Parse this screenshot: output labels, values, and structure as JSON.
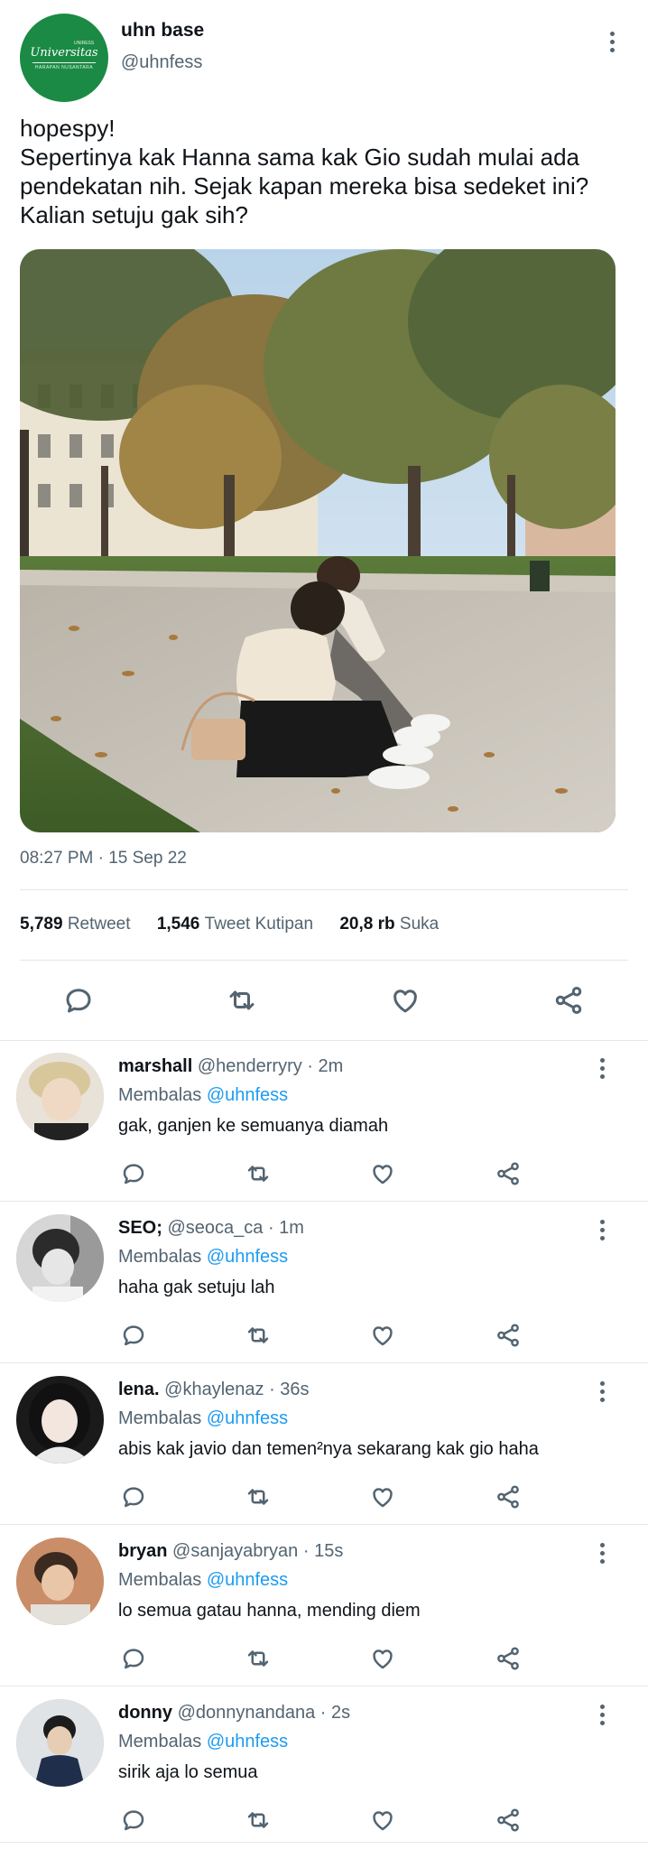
{
  "main_tweet": {
    "account_name": "uhn base",
    "handle": "@uhnfess",
    "avatar_logo": {
      "script": "Universitas",
      "small": "HARAPAN NUSANTARA",
      "corner": "UNIRESS",
      "color": "#1b8a44"
    },
    "text_lines": [
      "hopespy!",
      "Sepertinya kak Hanna sama kak Gio sudah mulai ada",
      "pendekatan nih. Sejak kapan mereka bisa sedeket ini?",
      "Kalian setuju gak sih?"
    ],
    "timestamp": "08:27 PM · 15 Sep 22",
    "stats": {
      "retweets_count": "5,789",
      "retweets_label": "Retweet",
      "quotes_count": "1,546",
      "quotes_label": "Tweet Kutipan",
      "likes_count": "20,8 rb",
      "likes_label": "Suka"
    },
    "actions": [
      "reply-icon",
      "retweet-icon",
      "like-icon",
      "share-icon"
    ]
  },
  "replies": [
    {
      "name": "marshall",
      "handle": "@henderryry",
      "time": "· 2m",
      "replying_label": "Membalas",
      "mention": "@uhnfess",
      "text": "gak, ganjen ke semuanya diamah"
    },
    {
      "name": "SEO;",
      "handle": "@seoca_ca",
      "time": "· 1m",
      "replying_label": "Membalas",
      "mention": "@uhnfess",
      "text": "haha gak setuju lah"
    },
    {
      "name": "lena.",
      "handle": "@khaylenaz",
      "time": "· 36s",
      "replying_label": "Membalas",
      "mention": "@uhnfess",
      "text": "abis kak javio dan temen²nya sekarang kak gio haha"
    },
    {
      "name": "bryan",
      "handle": "@sanjayabryan",
      "time": "· 15s",
      "replying_label": "Membalas",
      "mention": "@uhnfess",
      "text": "lo semua gatau hanna, mending diem"
    },
    {
      "name": "donny",
      "handle": "@donnynandana",
      "time": "· 2s",
      "replying_label": "Membalas",
      "mention": "@uhnfess",
      "text": "sirik aja lo semua"
    }
  ],
  "colors": {
    "accent": "#1d9bf0",
    "secondary_text": "#536471",
    "primary_text": "#0f1419"
  }
}
